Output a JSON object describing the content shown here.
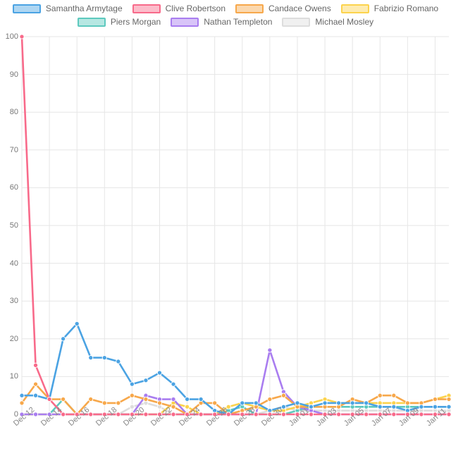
{
  "chart_data": {
    "type": "line",
    "title": "",
    "xlabel": "",
    "ylabel": "",
    "ylim": [
      0,
      100
    ],
    "yticks": [
      0,
      10,
      20,
      30,
      40,
      50,
      60,
      70,
      80,
      90,
      100
    ],
    "grid": true,
    "legend_position": "top",
    "x": [
      "Dec 12",
      "Dec 13",
      "Dec 14",
      "Dec 15",
      "Dec 16",
      "Dec 17",
      "Dec 18",
      "Dec 19",
      "Dec 20",
      "Dec 21",
      "Dec 22",
      "Dec 23",
      "Dec 24",
      "Dec 25",
      "Dec 26",
      "Dec 27",
      "Dec 28",
      "Dec 29",
      "Dec 30",
      "Dec 31",
      "Jan 01",
      "Jan 02",
      "Jan 03",
      "Jan 04",
      "Jan 05",
      "Jan 06",
      "Jan 07",
      "Jan 08",
      "Jan 09",
      "Jan 10",
      "Jan 11",
      "Jan 12"
    ],
    "xticks": [
      "Dec 12",
      "Dec 14",
      "Dec 16",
      "Dec 18",
      "Dec 20",
      "Dec 22",
      "Dec 24",
      "Dec 26",
      "Dec 28",
      "Dec 30",
      "Jan 01",
      "Jan 03",
      "Jan 05",
      "Jan 07",
      "Jan 09",
      "Jan 11"
    ],
    "series": [
      {
        "name": "Samantha Armytage",
        "color": "#4BA3E3",
        "values": [
          5,
          5,
          4,
          20,
          24,
          15,
          15,
          14,
          8,
          9,
          11,
          8,
          4,
          4,
          1,
          0,
          3,
          3,
          1,
          2,
          3,
          2,
          3,
          3,
          3,
          3,
          2,
          2,
          1,
          2,
          2,
          2
        ]
      },
      {
        "name": "Clive Robertson",
        "color": "#F86A8A",
        "values": [
          100,
          13,
          4,
          0,
          0,
          0,
          0,
          0,
          0,
          0,
          0,
          0,
          0,
          0,
          0,
          0,
          0,
          0,
          0,
          0,
          0,
          0,
          0,
          0,
          0,
          0,
          0,
          0,
          0,
          0,
          0,
          0
        ]
      },
      {
        "name": "Candace Owens",
        "color": "#F7A84B",
        "values": [
          3,
          8,
          4,
          4,
          0,
          4,
          3,
          3,
          5,
          4,
          3,
          2,
          0,
          3,
          3,
          0,
          1,
          2,
          4,
          5,
          2,
          2,
          2,
          2,
          4,
          3,
          5,
          5,
          3,
          3,
          4,
          4
        ]
      },
      {
        "name": "Fabrizio Romano",
        "color": "#FCD34D",
        "values": [
          0,
          0,
          0,
          0,
          0,
          0,
          0,
          0,
          0,
          0,
          0,
          3,
          2,
          0,
          0,
          2,
          3,
          2,
          1,
          1,
          2,
          3,
          4,
          3,
          3,
          3,
          3,
          3,
          3,
          3,
          4,
          5
        ]
      },
      {
        "name": "Piers Morgan",
        "color": "#5DC9BE",
        "values": [
          0,
          0,
          0,
          4,
          0,
          0,
          0,
          0,
          0,
          0,
          0,
          0,
          0,
          0,
          0,
          1,
          2,
          0,
          0,
          0,
          1,
          2,
          2,
          2,
          2,
          2,
          2,
          2,
          2,
          2,
          2,
          2
        ]
      },
      {
        "name": "Nathan Templeton",
        "color": "#A97DF0",
        "values": [
          0,
          0,
          0,
          0,
          0,
          0,
          0,
          0,
          0,
          5,
          4,
          4,
          0,
          0,
          0,
          0,
          0,
          0,
          17,
          6,
          2,
          1,
          0,
          0,
          0,
          0,
          0,
          0,
          0,
          0,
          0,
          0
        ]
      },
      {
        "name": "Michael Mosley",
        "color": "#DDDDDD",
        "values": [
          0,
          0,
          0,
          0,
          0,
          0,
          0,
          0,
          2,
          3,
          2,
          0,
          0,
          0,
          0,
          0,
          0,
          0,
          1,
          2,
          1,
          1,
          1,
          1,
          1,
          1,
          1,
          1,
          1,
          1,
          1,
          1
        ]
      }
    ]
  },
  "legend": {
    "rows": [
      [
        {
          "label": "Samantha Armytage",
          "color": "#4BA3E3"
        },
        {
          "label": "Clive Robertson",
          "color": "#F86A8A"
        },
        {
          "label": "Candace Owens",
          "color": "#F7A84B"
        },
        {
          "label": "Fabrizio Romano",
          "color": "#FCD34D"
        }
      ],
      [
        {
          "label": "Piers Morgan",
          "color": "#5DC9BE"
        },
        {
          "label": "Nathan Templeton",
          "color": "#A97DF0"
        },
        {
          "label": "Michael Mosley",
          "color": "#DDDDDD"
        }
      ]
    ]
  }
}
